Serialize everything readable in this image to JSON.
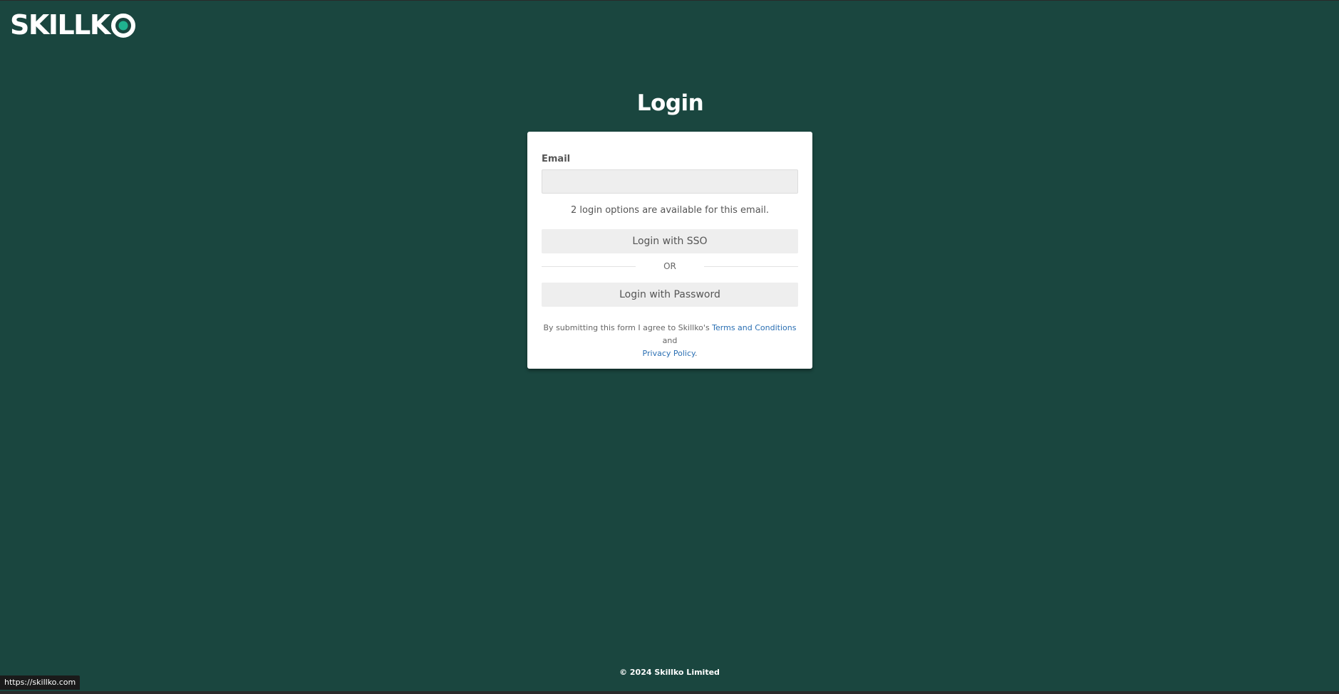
{
  "brand": {
    "logo_text": "SKILLK",
    "colors": {
      "background": "#1a463f",
      "accent": "#1fb38f",
      "link": "#2a6fb3"
    }
  },
  "page": {
    "title": "Login"
  },
  "form": {
    "email_label": "Email",
    "email_value": "",
    "email_placeholder": "",
    "options_hint": "2 login options are available for this email.",
    "sso_button_label": "Login with SSO",
    "divider_label": "OR",
    "password_button_label": "Login with Password",
    "legal": {
      "prefix": "By submitting this form I agree to Skillko's ",
      "terms_link": "Terms and Conditions",
      "middle": " and ",
      "privacy_link": "Privacy Policy",
      "suffix": "."
    }
  },
  "footer": {
    "copyright": "© 2024 Skillko Limited"
  },
  "status_bar": {
    "url": "https://skillko.com"
  }
}
